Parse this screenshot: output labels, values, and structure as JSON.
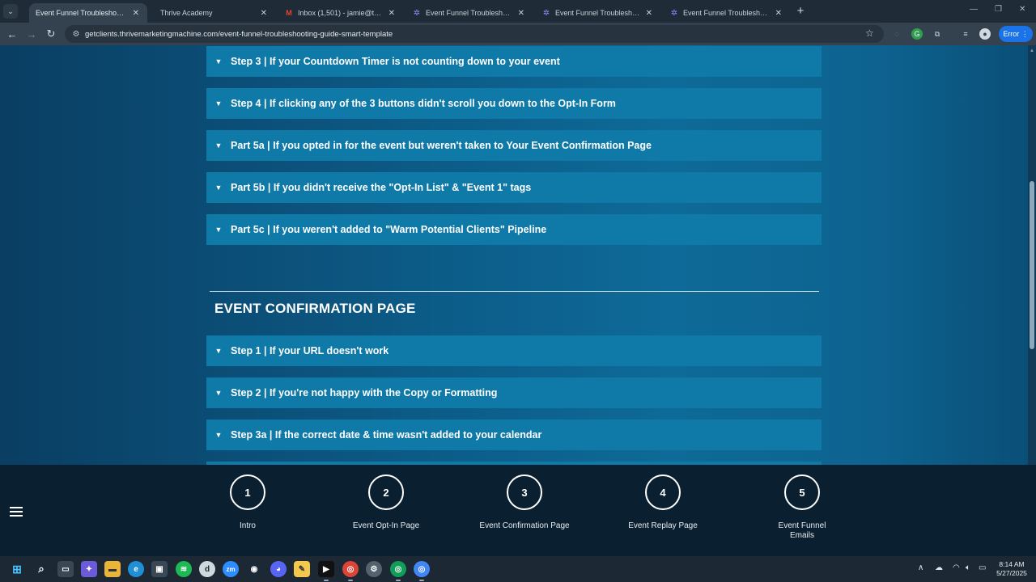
{
  "browser": {
    "tabs": [
      {
        "title": "Event Funnel Troubleshooting G",
        "active": true,
        "favicon": "page-icon"
      },
      {
        "title": "Thrive Academy",
        "active": false,
        "favicon": "none"
      },
      {
        "title": "Inbox (1,501) - jamie@thrive-a",
        "active": false,
        "favicon": "gmail-icon"
      },
      {
        "title": "Event Funnel Troubleshooting G",
        "active": false,
        "favicon": "gear-icon"
      },
      {
        "title": "Event Funnel Troubleshooting G",
        "active": false,
        "favicon": "gear-icon"
      },
      {
        "title": "Event Funnel Troubleshooting G",
        "active": false,
        "favicon": "gear-icon"
      }
    ],
    "url": "getclients.thrivemarketingmachine.com/event-funnel-troubleshooting-guide-smart-template",
    "error_label": "Error"
  },
  "page": {
    "accordion_top": [
      "Step 3 | If your Countdown Timer is not counting down to your event",
      "Step 4 | If clicking any of the 3 buttons didn't scroll you down to the Opt-In Form",
      "Part 5a | If you opted in for the event but weren't taken to Your Event Confirmation Page",
      "Part 5b | If you didn't receive the \"Opt-In List\" & \"Event 1\" tags",
      "Part 5c | If you weren't added to \"Warm Potential Clients\" Pipeline"
    ],
    "section_title": "EVENT CONFIRMATION PAGE",
    "accordion_bottom": [
      "Step 1 | If your URL doesn't work",
      "Step 2 | If you're not happy with the Copy or Formatting",
      "Step 3a | If the correct date & time wasn't added to your calendar"
    ]
  },
  "bottom_nav": {
    "steps": [
      {
        "number": "1",
        "label": "Intro"
      },
      {
        "number": "2",
        "label": "Event Opt-In Page"
      },
      {
        "number": "3",
        "label": "Event Confirmation Page"
      },
      {
        "number": "4",
        "label": "Event Replay Page"
      },
      {
        "number": "5",
        "label": "Event Funnel Emails"
      }
    ]
  },
  "taskbar": {
    "time": "8:14 AM",
    "date": "5/27/2025"
  },
  "colors": {
    "accordion_bg": "#0f79a8",
    "nav_bg": "#0a1f30",
    "error_pill": "#1a73e8"
  }
}
